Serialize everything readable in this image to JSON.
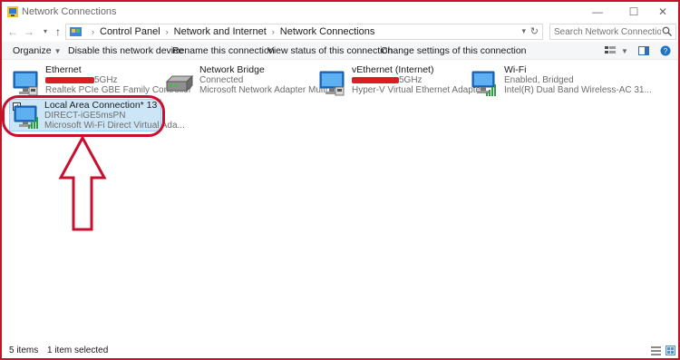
{
  "window": {
    "title": "Network Connections",
    "minimize": "—",
    "maximize": "☐",
    "close": "✕"
  },
  "address": {
    "back": "←",
    "forward": "→",
    "up": "↑",
    "crumbs": [
      "Control Panel",
      "Network and Internet",
      "Network Connections"
    ],
    "search_placeholder": "Search Network Connections"
  },
  "commands": {
    "organize": "Organize",
    "disable": "Disable this network device",
    "rename": "Rename this connection",
    "view_status": "View status of this connection",
    "change_settings": "Change settings of this connection"
  },
  "connections": [
    {
      "name": "Ethernet",
      "status": "5GHz",
      "device": "Realtek PCIe GBE Family Controller"
    },
    {
      "name": "Network Bridge",
      "status": "Connected",
      "device": "Microsoft Network Adapter Multi..."
    },
    {
      "name": "vEthernet (Internet)",
      "status": "5GHz",
      "device": "Hyper-V Virtual Ethernet Adapter"
    },
    {
      "name": "Wi-Fi",
      "status": "Enabled, Bridged",
      "device": "Intel(R) Dual Band Wireless-AC 31..."
    },
    {
      "name": "Local Area Connection* 13",
      "status": "DIRECT-iGE5msPN",
      "device": "Microsoft Wi-Fi Direct Virtual Ada..."
    }
  ],
  "statusbar": {
    "count": "5 items",
    "selected": "1 item selected"
  },
  "colors": {
    "annotation_red": "#c8102e",
    "selection_bg": "#cde6f7",
    "selection_border": "#99d1ff",
    "wifi_green": "#2e9e3e",
    "monitor_blue": "#1e72c9"
  }
}
